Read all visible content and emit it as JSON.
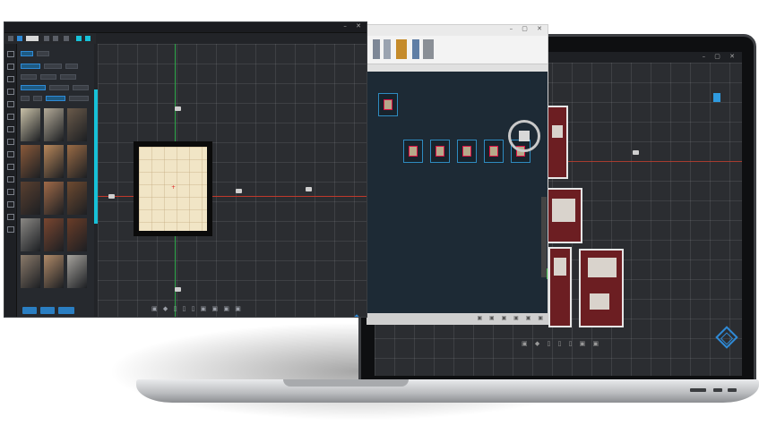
{
  "left_window": {
    "footer_buttons": [
      "",
      "",
      ""
    ],
    "materials": [
      {
        "color": "#c9c1a8"
      },
      {
        "color": "#b3aa98"
      },
      {
        "color": "#6a5a4a"
      },
      {
        "color": "#8a5a3a"
      },
      {
        "color": "#b8875a"
      },
      {
        "color": "#9a6b45"
      },
      {
        "color": "#5a4030"
      },
      {
        "color": "#a06a48"
      },
      {
        "color": "#6e4a30"
      },
      {
        "color": "#8a8884"
      },
      {
        "color": "#7a4630"
      },
      {
        "color": "#6a3d28"
      },
      {
        "color": "#8a7a6a"
      },
      {
        "color": "#b08a68"
      },
      {
        "color": "#a6a39d"
      },
      {
        "color": "#6a6055"
      },
      {
        "color": "#a9a49c"
      },
      {
        "color": "#8c8a86"
      }
    ],
    "accent_color": "#17c1d8"
  },
  "middle_window": {
    "thumbnail_count": 6
  },
  "laptop_window": {
    "accent_color": "#2f9be0"
  },
  "colors": {
    "axis_x": "#c0392b",
    "axis_y": "#2ea84a",
    "nav_diamond": "#2f8ad6"
  }
}
